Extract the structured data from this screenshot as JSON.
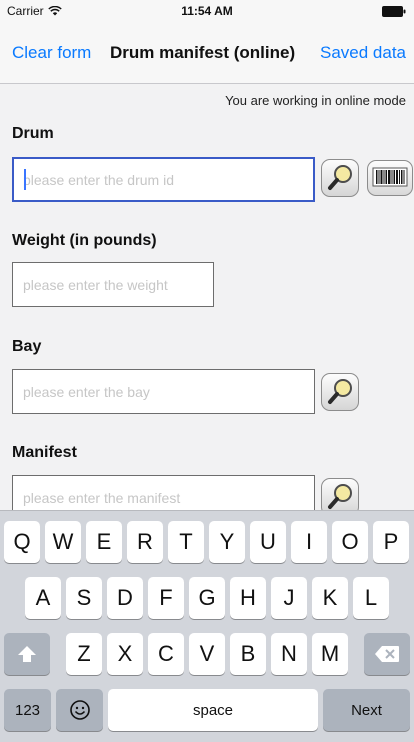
{
  "status": {
    "carrier": "Carrier",
    "time": "11:54 AM",
    "icons": [
      "wifi-icon",
      "battery-icon"
    ]
  },
  "nav": {
    "left_button": "Clear form",
    "title": "Drum manifest (online)",
    "right_button": "Saved data"
  },
  "mode_text": "You are working in online mode",
  "fields": {
    "drum": {
      "label": "Drum",
      "placeholder": "please enter the drum id",
      "value": ""
    },
    "weight": {
      "label": "Weight (in pounds)",
      "placeholder": "please enter the weight",
      "value": ""
    },
    "bay": {
      "label": "Bay",
      "placeholder": "please enter the bay",
      "value": ""
    },
    "manifest": {
      "label": "Manifest",
      "placeholder": "please enter the manifest",
      "value": ""
    }
  },
  "keyboard": {
    "row1": [
      "Q",
      "W",
      "E",
      "R",
      "T",
      "Y",
      "U",
      "I",
      "O",
      "P"
    ],
    "row2": [
      "A",
      "S",
      "D",
      "F",
      "G",
      "H",
      "J",
      "K",
      "L"
    ],
    "row3": [
      "Z",
      "X",
      "C",
      "V",
      "B",
      "N",
      "M"
    ],
    "numbers_key": "123",
    "space_key": "space",
    "next_key": "Next"
  },
  "colors": {
    "accent": "#0a7aff",
    "focus_border": "#3a5bc7",
    "keyboard_bg": "#d2d5db"
  }
}
